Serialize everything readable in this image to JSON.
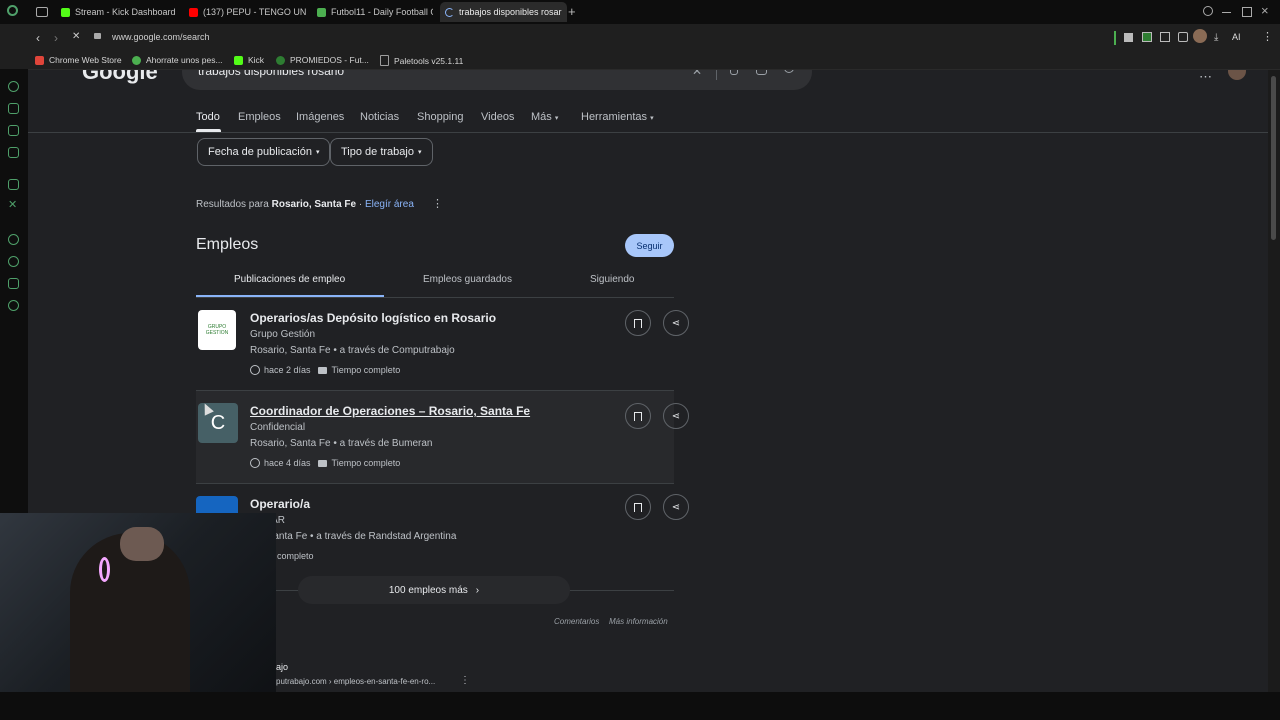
{
  "tabs": [
    {
      "title": "Stream - Kick Dashboard",
      "color": "#53fc18"
    },
    {
      "title": "(137) PEPU - TENGO UN F",
      "color": "#ff0000"
    },
    {
      "title": "Futbol11 - Daily Football G",
      "color": "#4caf50"
    },
    {
      "title": "trabajos disponibles rosar",
      "color": "#8ab4f8"
    }
  ],
  "new_tab_symbol": "+",
  "address_bar": {
    "url": "www.google.com/search"
  },
  "extensions": {
    "ai_label": "AI"
  },
  "bookmarks": [
    {
      "label": "Chrome Web Store",
      "color": "#e0453a"
    },
    {
      "label": "Ahorrate unos pes...",
      "color": "#4caf50"
    },
    {
      "label": "Kick",
      "color": "#53fc18"
    },
    {
      "label": "PROMIEDOS - Fut...",
      "color": "#2e7d32"
    },
    {
      "label": "Paletools v25.1.11",
      "color": "#9e9e9e"
    }
  ],
  "google": {
    "logo": "Google",
    "search_query": "trabajos disponibles rosario"
  },
  "nav_tabs": [
    "Todo",
    "Empleos",
    "Imágenes",
    "Noticias",
    "Shopping",
    "Videos",
    "Más",
    "Herramientas"
  ],
  "filters": [
    "Fecha de publicación",
    "Tipo de trabajo"
  ],
  "results_for": {
    "prefix": "Resultados para",
    "location": "Rosario, Santa Fe",
    "link": "Elegír área"
  },
  "jobs": {
    "heading": "Empleos",
    "follow_button": "Seguir",
    "subtabs": [
      "Publicaciones de empleo",
      "Empleos guardados",
      "Siguiendo"
    ],
    "listings": [
      {
        "title": "Operarios/as Depósito logístico en Rosario",
        "company": "Grupo Gestión",
        "location": "Rosario, Santa Fe • a través de Computrabajo",
        "posted": "hace 2 días",
        "type": "Tiempo completo",
        "logo_text": "GRUPO GESTION"
      },
      {
        "title": "Coordinador de Operaciones – Rosario, Santa Fe",
        "company": "Confidencial",
        "location": "Rosario, Santa Fe • a través de Bumeran",
        "posted": "hace 4 días",
        "type": "Tiempo completo",
        "logo_text": "C"
      },
      {
        "title": "Operario/a",
        "company": "stad AR",
        "location": "rio, Santa Fe • a través de Randstad Argentina",
        "posted": "",
        "type": "iempo completo",
        "logo_text": ""
      }
    ],
    "more_jobs": "100 empleos más",
    "footer_links": [
      "Comentarios",
      "Más información"
    ]
  },
  "next_result": {
    "title": "ajo",
    "url": "putrabajo.com › empleos-en-santa-fe-en-ro..."
  }
}
